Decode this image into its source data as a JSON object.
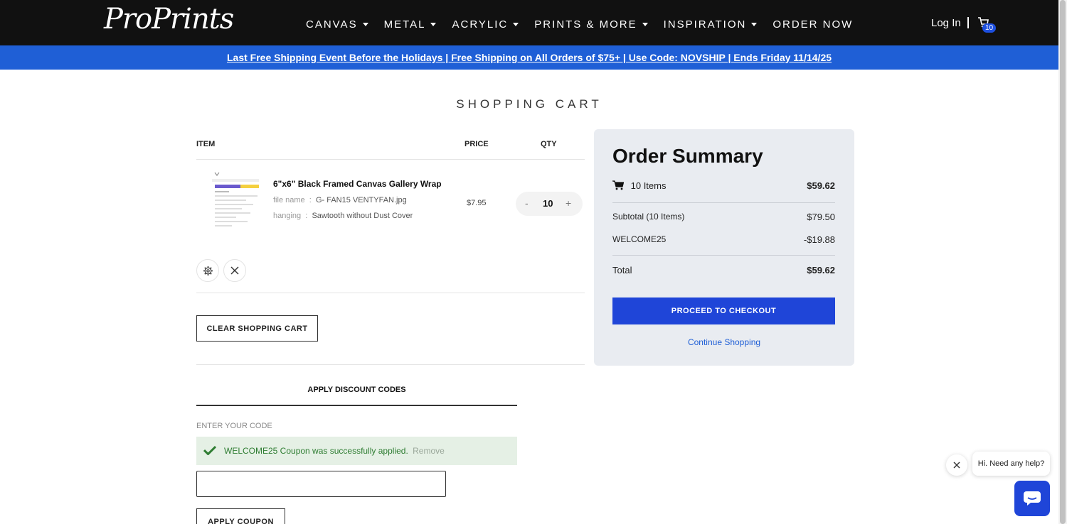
{
  "brand": {
    "logo_text": "ProPrints"
  },
  "nav": {
    "items": [
      {
        "label": "CANVAS",
        "has_dropdown": true
      },
      {
        "label": "METAL",
        "has_dropdown": true
      },
      {
        "label": "ACRYLIC",
        "has_dropdown": true
      },
      {
        "label": "PRINTS & MORE",
        "has_dropdown": true
      },
      {
        "label": "INSPIRATION",
        "has_dropdown": true
      },
      {
        "label": "ORDER NOW",
        "has_dropdown": false
      }
    ],
    "login_label": "Log In",
    "cart_count": "10"
  },
  "promo": {
    "text": "Last Free Shipping Event Before the Holidays | Free Shipping on All Orders of $75+ | Use Code: NOVSHIP | Ends Friday 11/14/25"
  },
  "page_title": "SHOPPING CART",
  "cart": {
    "headers": {
      "item": "ITEM",
      "price": "PRICE",
      "qty": "QTY"
    },
    "item": {
      "name": "6\"x6\" Black Framed Canvas Gallery Wrap",
      "file_name_label": "file name",
      "file_name_value": "G- FAN15 VENTYFAN.jpg",
      "hanging_label": "hanging",
      "hanging_value": "Sawtooth without Dust Cover",
      "separator": ":",
      "price": "$7.95",
      "qty": "10",
      "minus": "-",
      "plus": "+"
    },
    "clear_label": "CLEAR SHOPPING CART"
  },
  "discount": {
    "title": "APPLY DISCOUNT CODES",
    "enter_label": "ENTER YOUR CODE",
    "success_message": "WELCOME25 Coupon was successfully applied.",
    "remove_label": "Remove",
    "input_value": "",
    "apply_label": "APPLY COUPON"
  },
  "summary": {
    "title": "Order Summary",
    "items_label": "10 Items",
    "items_total": "$59.62",
    "subtotal_label": "Subtotal (10 Items)",
    "subtotal_value": "$79.50",
    "coupon_label": "WELCOME25",
    "coupon_value": "-$19.88",
    "total_label": "Total",
    "total_value": "$59.62",
    "checkout_label": "PROCEED TO CHECKOUT",
    "continue_label": "Continue Shopping"
  },
  "chat": {
    "bubble_text": "Hi. Need any help?"
  },
  "colors": {
    "header_bg": "#111111",
    "promo_bg": "#1f5fd6",
    "button_blue": "#1f45d8",
    "summary_bg": "#e9ecf1",
    "success_green": "#2e7d32"
  }
}
